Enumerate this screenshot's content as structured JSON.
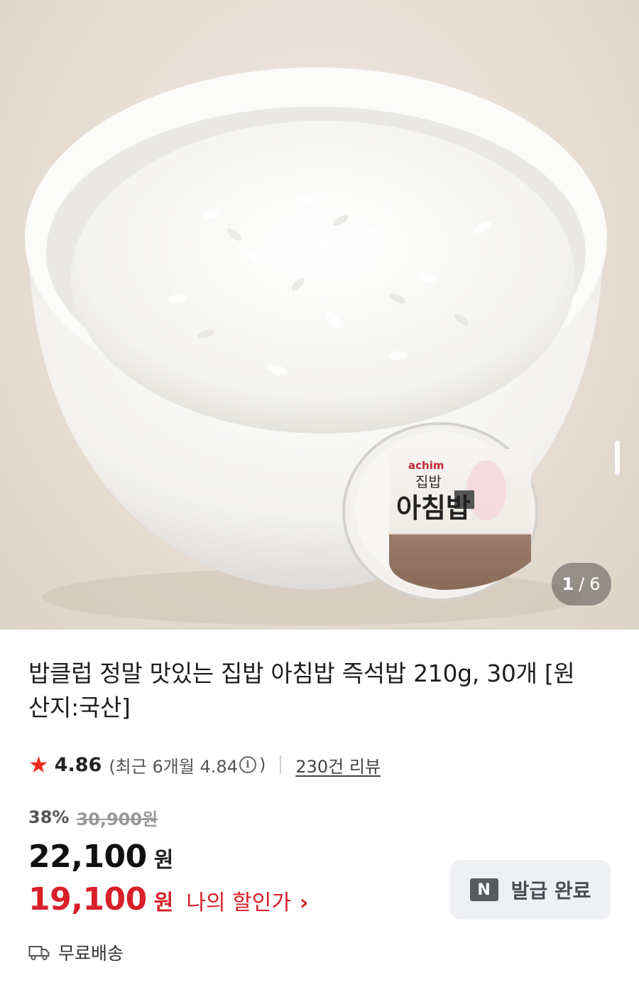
{
  "hero": {
    "package_brand": "achim",
    "package_sub": "집밥",
    "package_name": "아침밥",
    "counter_current": "1",
    "counter_total": "6"
  },
  "product": {
    "title_line1": "밥클럽 정말 맛있는 집밥 아침밥 즉석밥 210g, 30개 [원",
    "title_line2": "산지:국산]",
    "rating": "4.86",
    "recent_rating_prefix": "(최근 6개월 4.84",
    "recent_rating_suffix": ")",
    "info_icon": "i",
    "review_count": "230건 리뷰"
  },
  "price": {
    "discount_pct": "38%",
    "original": "30,900원",
    "sale": "22,100",
    "won": "원",
    "my_price": "19,100",
    "my_price_label": "나의 할인가",
    "chevron": "›"
  },
  "coupon": {
    "badge": "N",
    "label": "발급 완료"
  },
  "shipping": {
    "label": "무료배송"
  },
  "colors": {
    "accent_red": "#d8202a",
    "star": "#f0281e"
  }
}
